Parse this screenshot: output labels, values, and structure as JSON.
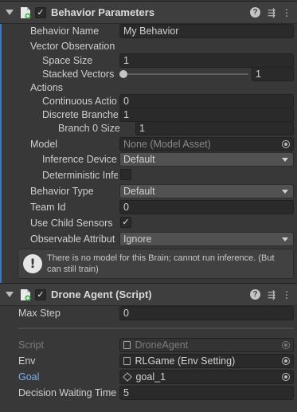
{
  "behavior_parameters": {
    "title": "Behavior Parameters",
    "behavior_name": {
      "label": "Behavior Name",
      "value": "My Behavior"
    },
    "vector_observation": {
      "label": "Vector Observation",
      "space_size": {
        "label": "Space Size",
        "value": "1"
      },
      "stacked_vectors": {
        "label": "Stacked Vectors",
        "value": "1",
        "slider_fraction": 0.0
      }
    },
    "actions": {
      "label": "Actions",
      "continuous": {
        "label": "Continuous Actio",
        "value": "0"
      },
      "discrete": {
        "label": "Discrete Branche",
        "value": "1"
      },
      "branch0": {
        "label": "Branch 0 Size",
        "value": "1"
      }
    },
    "model": {
      "label": "Model",
      "value": "None (Model Asset)"
    },
    "inference_device": {
      "label": "Inference Device",
      "value": "Default"
    },
    "deterministic": {
      "label": "Deterministic Infe",
      "checked": false
    },
    "behavior_type": {
      "label": "Behavior Type",
      "value": "Default"
    },
    "team_id": {
      "label": "Team Id",
      "value": "0"
    },
    "use_child_sensors": {
      "label": "Use Child Sensors",
      "checked": true,
      "check_glyph": "✓"
    },
    "observable_attribute": {
      "label": "Observable Attribut",
      "value": "Ignore"
    },
    "warning": {
      "icon": "exclamation-icon",
      "text": "There is no model for this Brain; cannot run inference. (But can still train)"
    }
  },
  "drone_agent": {
    "title": "Drone Agent (Script)",
    "max_step": {
      "label": "Max Step",
      "value": "0"
    },
    "script": {
      "label": "Script",
      "value": "DroneAgent"
    },
    "env": {
      "label": "Env",
      "value": "RLGame (Env Setting)"
    },
    "goal": {
      "label": "Goal",
      "value": "goal_1"
    },
    "decision_waiting_time": {
      "label": "Decision Waiting Time",
      "value": "5"
    }
  },
  "header_icons": {
    "enabled_glyph": "✓",
    "help": "?",
    "presets": "⇶",
    "menu": "⋮"
  },
  "colors": {
    "accent": "#3a79bb",
    "background": "#383838",
    "header": "#3e3e3e",
    "field": "#2a2a2a"
  }
}
